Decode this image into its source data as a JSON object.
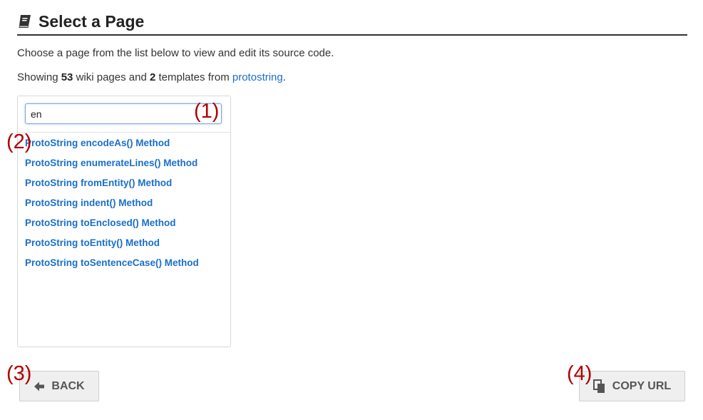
{
  "header": {
    "title": "Select a Page",
    "icon": "book-icon"
  },
  "intro": "Choose a page from the list below to view and edit its source code.",
  "summary": {
    "showing": "Showing ",
    "page_count": "53",
    "pages_text": " wiki pages and ",
    "template_count": "2",
    "templates_text": " templates from ",
    "source": "protostring",
    "period": "."
  },
  "search": {
    "value": "en"
  },
  "results": [
    "ProtoString encodeAs() Method",
    "ProtoString enumerateLines() Method",
    "ProtoString fromEntity() Method",
    "ProtoString indent() Method",
    "ProtoString toEnclosed() Method",
    "ProtoString toEntity() Method",
    "ProtoString toSentenceCase() Method"
  ],
  "buttons": {
    "back": "BACK",
    "back_icon": "arrow-left-icon",
    "copy_url": "COPY URL",
    "copy_icon": "copy-icon"
  },
  "markers": {
    "m1": "(1)",
    "m2": "(2)",
    "m3": "(3)",
    "m4": "(4)"
  },
  "colors": {
    "link": "#1a6fc9",
    "marker": "#b00000",
    "button_bg": "#efefef"
  }
}
